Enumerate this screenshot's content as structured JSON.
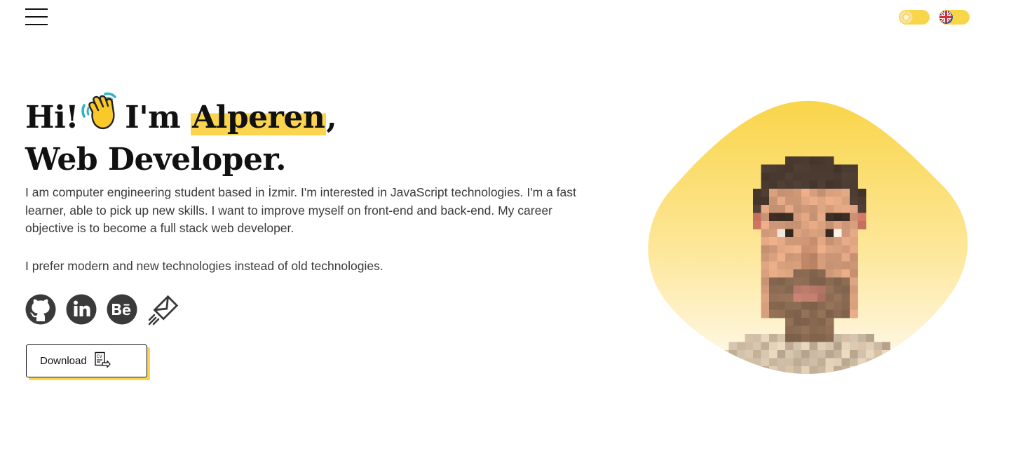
{
  "header": {
    "menu_icon": "hamburger-menu-icon",
    "theme_toggle_icon": "sun-icon",
    "language_toggle_icon": "uk-flag-icon",
    "accent_color": "#f9d54a"
  },
  "hero": {
    "greeting": "Hi!",
    "greeting_icon": "waving-hand-icon",
    "intro_prefix": "I'm",
    "name": "Alperen",
    "name_suffix": ",",
    "role": "Web Developer.",
    "paragraph_1": "I am computer engineering student based in İzmir. I'm interested in JavaScript technologies. I'm a fast learner, able to pick up new skills. I want to improve myself on front-end and back-end. My career objective is to become a full stack web developer.",
    "paragraph_2": "I prefer modern and new technologies instead of old technologies."
  },
  "socials": [
    {
      "name": "GitHub",
      "icon": "github-icon"
    },
    {
      "name": "LinkedIn",
      "icon": "linkedin-icon"
    },
    {
      "name": "Behance",
      "icon": "behance-icon"
    },
    {
      "name": "Email",
      "icon": "mail-icon"
    }
  ],
  "download": {
    "label": "Download",
    "icon": "cv-download-icon"
  },
  "avatar": {
    "icon": "pixel-portrait-avatar",
    "blob_gradient_top": "#f9d54a",
    "blob_gradient_bottom": "#fffaf0"
  }
}
